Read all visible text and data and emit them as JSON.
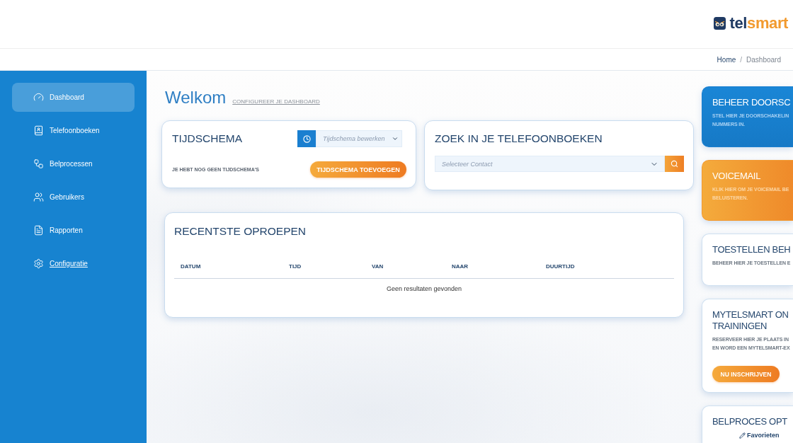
{
  "header": {
    "logo": {
      "parts": [
        "tel",
        "smart"
      ]
    }
  },
  "breadcrumb": {
    "items": [
      {
        "label": "Home",
        "current": false
      },
      {
        "label": "Dashboard",
        "current": true
      }
    ],
    "separator": "/"
  },
  "sidebar": {
    "items": [
      {
        "label": "Dashboard",
        "selected": true,
        "hovered": false
      },
      {
        "label": "Telefoonboeken",
        "selected": false,
        "hovered": false
      },
      {
        "label": "Belprocessen",
        "selected": false,
        "hovered": false
      },
      {
        "label": "Gebruikers",
        "selected": false,
        "hovered": false
      },
      {
        "label": "Rapporten",
        "selected": false,
        "hovered": false
      },
      {
        "label": "Configuratie",
        "selected": false,
        "hovered": true
      }
    ]
  },
  "welcome": {
    "title": "Welkom",
    "link": "CONFIGUREER JE DASHBOARD"
  },
  "schedule_card": {
    "title": "TIJDSCHEMA",
    "select": {
      "placeholder": "Tijdschema bewerken"
    },
    "message": "JE HEBT NOG GEEN TIJDSCHEMA'S",
    "button": "TIJDSCHEMA TOEVOEGEN"
  },
  "phonebook_card": {
    "title": "ZOEK IN JE TELEFOONBOEKEN",
    "select": {
      "placeholder": "Selecteer Contact"
    }
  },
  "recent_calls": {
    "title": "RECENTSTE OPROEPEN",
    "table": {
      "columns": [
        "DATUM",
        "TIJD",
        "VAN",
        "NAAR",
        "DUURTIJD"
      ],
      "empty_message": "Geen resultaten gevonden"
    }
  },
  "tiles": [
    {
      "kind": "primary",
      "title_lines": [
        "BEHEER DOORSC"
      ],
      "description_lines": [
        "STEL HIER JE DOORSCHAKELIN",
        "NUMMERS IN."
      ]
    },
    {
      "kind": "accent",
      "title_lines": [
        "VOICEMAIL"
      ],
      "description_lines": [
        "KLIK HIER OM JE VOICEMAIL BE",
        "BELUISTEREN."
      ]
    },
    {
      "kind": "plain",
      "title_lines": [
        "TOESTELLEN BEH"
      ],
      "description_lines": [
        "BEHEER HIER JE TOESTELLEN E"
      ]
    },
    {
      "kind": "plain",
      "title_lines": [
        "MYTELSMART ON",
        "TRAININGEN"
      ],
      "description_lines": [
        "RESERVEER HIER JE PLAATS IN",
        "EN WORD EEN MYTELSMART-EX"
      ],
      "button": "NU INSCHRIJVEN"
    },
    {
      "kind": "plain",
      "title_lines": [
        "BELPROCES OPT"
      ],
      "link": "Favorieten"
    }
  ]
}
